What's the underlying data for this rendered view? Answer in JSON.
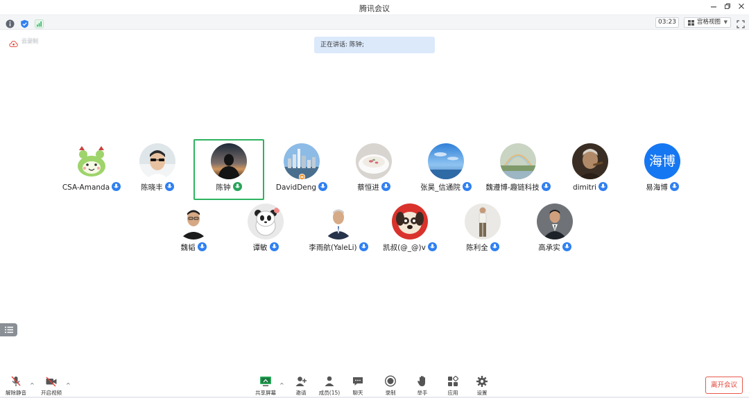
{
  "window": {
    "title": "腾讯会议",
    "controls": [
      "minimize-icon",
      "restore-icon",
      "close-icon"
    ]
  },
  "statusbar": {
    "icons": [
      "info-icon",
      "shield-icon",
      "signal-icon"
    ],
    "timer": "03:23",
    "view_mode": "宫格视图",
    "fullscreen_icon": "fullscreen-icon"
  },
  "cloud_record": {
    "icon": "cloud-record-icon",
    "text": "云录制"
  },
  "speaking": {
    "text": "正在讲话: 陈钟;"
  },
  "participants": [
    {
      "name": "CSA-Amanda",
      "avatar": "cartoon-frog",
      "mic": "mic-icon"
    },
    {
      "name": "陈晓丰",
      "avatar": "photo-sunglasses",
      "mic": "mic-icon"
    },
    {
      "name": "陈钟",
      "avatar": "photo-silhouette",
      "mic": "mic-speaking-icon",
      "active": true
    },
    {
      "name": "DavidDeng",
      "avatar": "photo-city",
      "mic": "mic-icon"
    },
    {
      "name": "蔡恒进",
      "avatar": "photo-bowl",
      "mic": "mic-icon"
    },
    {
      "name": "张昊_信通院",
      "avatar": "photo-sky",
      "mic": "mic-icon"
    },
    {
      "name": "魏遵博-趣链科技",
      "avatar": "photo-rainbow",
      "mic": "mic-icon"
    },
    {
      "name": "dimitri",
      "avatar": "photo-man-cigar",
      "mic": "mic-icon"
    },
    {
      "name": "易海博",
      "avatar_text": "海博",
      "mic": "mic-icon"
    },
    {
      "name": "魏韬",
      "avatar": "photo-man-glasses",
      "mic": "mic-icon"
    },
    {
      "name": "谭敏",
      "avatar": "cartoon-panda",
      "mic": "mic-icon"
    },
    {
      "name": "李雨航(YaleLi)",
      "avatar": "photo-man-suit",
      "mic": "mic-icon"
    },
    {
      "name": "凯叔(@_@)v",
      "avatar": "cartoon-dog",
      "mic": "mic-icon"
    },
    {
      "name": "陈利全",
      "avatar": "photo-standing",
      "mic": "mic-icon"
    },
    {
      "name": "高承实",
      "avatar": "photo-man-dark-suit",
      "mic": "mic-icon"
    }
  ],
  "toolbar": {
    "unmute": "解除静音",
    "start_video": "开启视频",
    "share_screen": "共享屏幕",
    "invite": "邀请",
    "members": "成员(15)",
    "chat": "聊天",
    "record": "录制",
    "raise_hand": "举手",
    "apps": "应用",
    "settings": "设置",
    "leave": "离开会议"
  },
  "colors": {
    "accent": "#2f7ff0",
    "active_border": "#2db35f",
    "leave_red": "#e3453a",
    "banner": "#dbe9fb"
  }
}
